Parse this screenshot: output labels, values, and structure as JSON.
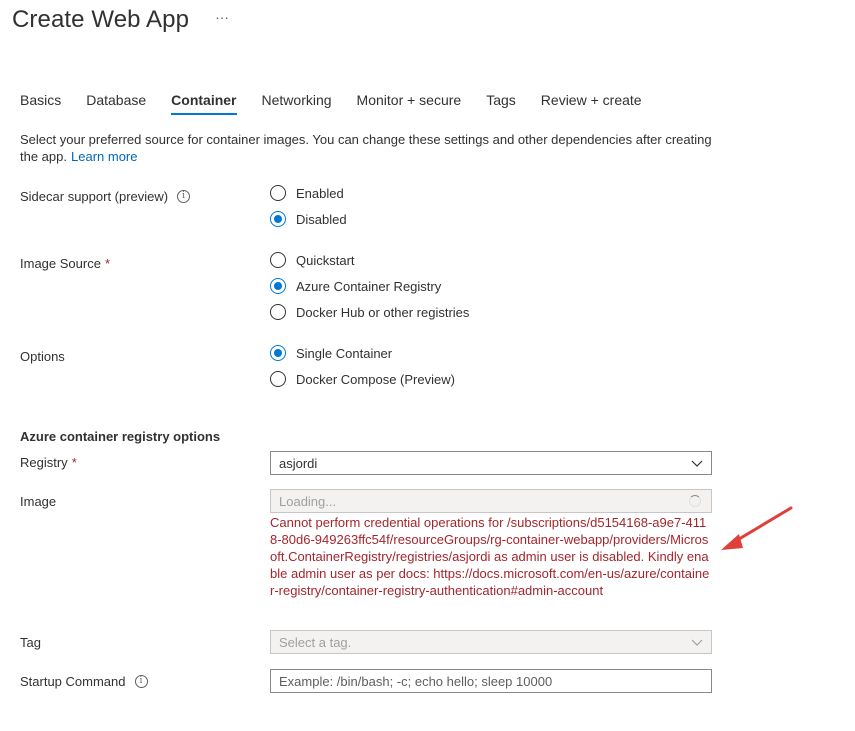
{
  "header": {
    "title": "Create Web App",
    "more": "···"
  },
  "tabs": [
    {
      "label": "Basics",
      "active": false
    },
    {
      "label": "Database",
      "active": false
    },
    {
      "label": "Container",
      "active": true
    },
    {
      "label": "Networking",
      "active": false
    },
    {
      "label": "Monitor + secure",
      "active": false
    },
    {
      "label": "Tags",
      "active": false
    },
    {
      "label": "Review + create",
      "active": false
    }
  ],
  "intro": {
    "text": "Select your preferred source for container images. You can change these settings and other dependencies after creating the app.",
    "link": "Learn more"
  },
  "sidecar": {
    "label": "Sidecar support (preview)",
    "info_icon": "i",
    "options": [
      {
        "label": "Enabled",
        "checked": false
      },
      {
        "label": "Disabled",
        "checked": true
      }
    ]
  },
  "image_source": {
    "label": "Image Source",
    "required": "*",
    "options": [
      {
        "label": "Quickstart",
        "checked": false
      },
      {
        "label": "Azure Container Registry",
        "checked": true
      },
      {
        "label": "Docker Hub or other registries",
        "checked": false
      }
    ]
  },
  "options": {
    "label": "Options",
    "options": [
      {
        "label": "Single Container",
        "checked": true
      },
      {
        "label": "Docker Compose (Preview)",
        "checked": false
      }
    ]
  },
  "acr": {
    "section_title": "Azure container registry options",
    "registry": {
      "label": "Registry",
      "required": "*",
      "value": "asjordi"
    },
    "image": {
      "label": "Image",
      "value": "Loading...",
      "error": "Cannot perform credential operations for /subscriptions/d5154168-a9e7-4118-80d6-949263ffc54f/resourceGroups/rg-container-webapp/providers/Microsoft.ContainerRegistry/registries/asjordi as admin user is disabled. Kindly enable admin user as per docs: https://docs.microsoft.com/en-us/azure/container-registry/container-registry-authentication#admin-account"
    },
    "tag": {
      "label": "Tag",
      "placeholder": "Select a tag."
    },
    "startup": {
      "label": "Startup Command",
      "info_icon": "i",
      "placeholder": "Example: /bin/bash; -c; echo hello; sleep 10000"
    }
  },
  "colors": {
    "accent": "#0078d4",
    "error": "#a4262c",
    "arrow": "#e0403a"
  }
}
